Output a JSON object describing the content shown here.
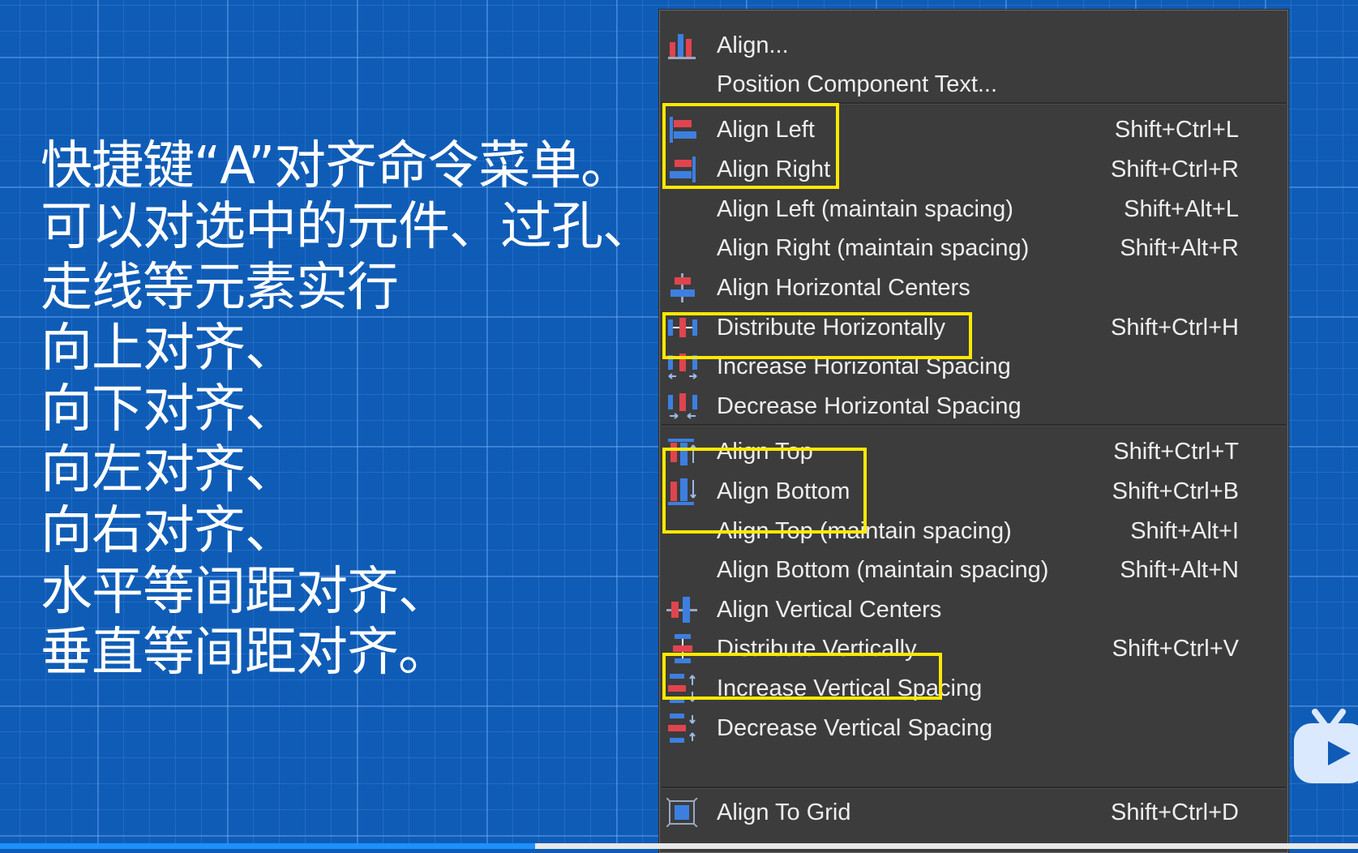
{
  "caption": {
    "lines": [
      "快捷键“A”对齐命令菜单。",
      "可以对选中的元件、过孔、",
      "走线等元素实行",
      "向上对齐、",
      "向下对齐、",
      "向左对齐、",
      "向右对齐、",
      "水平等间距对齐、",
      "垂直等间距对齐。"
    ]
  },
  "menu": {
    "items": [
      {
        "label": "Align...",
        "shortcut": "",
        "icon": "align-bars-icon"
      },
      {
        "label": "Position Component Text...",
        "shortcut": "",
        "icon": ""
      },
      {
        "label": "Align Left",
        "shortcut": "Shift+Ctrl+L",
        "icon": "align-left-icon"
      },
      {
        "label": "Align Right",
        "shortcut": "Shift+Ctrl+R",
        "icon": "align-right-icon"
      },
      {
        "label": "Align Left (maintain spacing)",
        "shortcut": "Shift+Alt+L",
        "icon": ""
      },
      {
        "label": "Align Right (maintain spacing)",
        "shortcut": "Shift+Alt+R",
        "icon": ""
      },
      {
        "label": "Align Horizontal Centers",
        "shortcut": "",
        "icon": "align-horizontal-centers-icon"
      },
      {
        "label": "Distribute Horizontally",
        "shortcut": "Shift+Ctrl+H",
        "icon": "distribute-horizontally-icon"
      },
      {
        "label": "Increase Horizontal Spacing",
        "shortcut": "",
        "icon": "increase-horizontal-spacing-icon"
      },
      {
        "label": "Decrease Horizontal Spacing",
        "shortcut": "",
        "icon": "decrease-horizontal-spacing-icon"
      },
      {
        "label": "Align Top",
        "shortcut": "Shift+Ctrl+T",
        "icon": "align-top-icon"
      },
      {
        "label": "Align Bottom",
        "shortcut": "Shift+Ctrl+B",
        "icon": "align-bottom-icon"
      },
      {
        "label": "Align Top (maintain spacing)",
        "shortcut": "Shift+Alt+I",
        "icon": ""
      },
      {
        "label": "Align Bottom (maintain spacing)",
        "shortcut": "Shift+Alt+N",
        "icon": ""
      },
      {
        "label": "Align Vertical Centers",
        "shortcut": "",
        "icon": "align-vertical-centers-icon"
      },
      {
        "label": "Distribute Vertically",
        "shortcut": "Shift+Ctrl+V",
        "icon": "distribute-vertically-icon"
      },
      {
        "label": "Increase Vertical Spacing",
        "shortcut": "",
        "icon": "increase-vertical-spacing-icon"
      },
      {
        "label": "Decrease Vertical Spacing",
        "shortcut": "",
        "icon": "decrease-vertical-spacing-icon"
      },
      {
        "label": "Align To Grid",
        "shortcut": "Shift+Ctrl+D",
        "icon": "align-to-grid-icon"
      }
    ]
  },
  "colors": {
    "background": "#0f5cb6",
    "menu_bg": "#3c3c3c",
    "menu_text": "#eeeeee",
    "highlight_box": "#ffe800",
    "icon_red": "#e0444e",
    "icon_blue": "#3d7fe0"
  }
}
